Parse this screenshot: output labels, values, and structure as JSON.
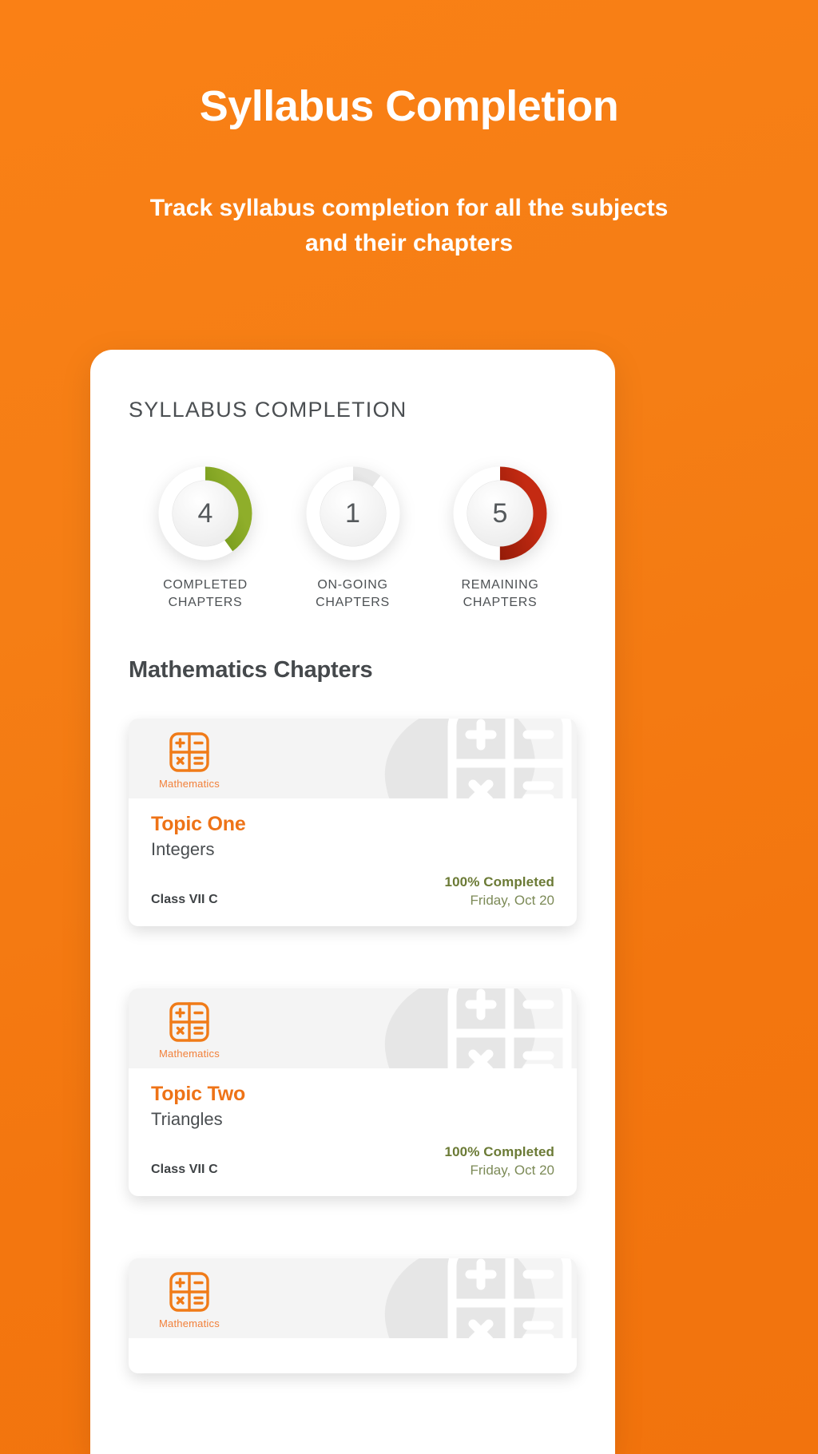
{
  "hero": {
    "title": "Syllabus Completion",
    "subtitle": "Track syllabus completion for all the subjects and their chapters"
  },
  "screen": {
    "title": "SYLLABUS COMPLETION",
    "section_heading": "Mathematics Chapters"
  },
  "colors": {
    "brand_orange": "#F47B16",
    "topic_orange": "#EE7317",
    "completed_green": "#5F8A12",
    "ongoing_grey": "#9A9A9A",
    "remaining_red": "#8E1B06",
    "pct_olive": "#6B7A35"
  },
  "stats": [
    {
      "value": "4",
      "label_line1": "COMPLETED",
      "label_line2": "CHAPTERS",
      "ring_color_start": "#4A7A05",
      "ring_color_end": "#8FAE2A",
      "percent": 40,
      "icon": "donut-ring-icon"
    },
    {
      "value": "1",
      "label_line1": "ON-GOING",
      "label_line2": "CHAPTERS",
      "ring_color_start": "#8E8E8E",
      "ring_color_end": "#E4E4E4",
      "percent": 10,
      "icon": "donut-ring-icon"
    },
    {
      "value": "5",
      "label_line1": "REMAINING",
      "label_line2": "CHAPTERS",
      "ring_color_start": "#6E1000",
      "ring_color_end": "#C42A12",
      "percent": 50,
      "icon": "donut-ring-icon"
    }
  ],
  "chapters": [
    {
      "subject": "Mathematics",
      "subject_icon": "calculator-icon",
      "topic": "Topic One",
      "chapter_name": "Integers",
      "class_name": "Class VII C",
      "completion": "100% Completed",
      "date": "Friday, Oct 20"
    },
    {
      "subject": "Mathematics",
      "subject_icon": "calculator-icon",
      "topic": "Topic Two",
      "chapter_name": "Triangles",
      "class_name": "Class VII C",
      "completion": "100% Completed",
      "date": "Friday, Oct 20"
    },
    {
      "subject": "Mathematics",
      "subject_icon": "calculator-icon",
      "topic": "",
      "chapter_name": "",
      "class_name": "",
      "completion": "",
      "date": ""
    }
  ]
}
